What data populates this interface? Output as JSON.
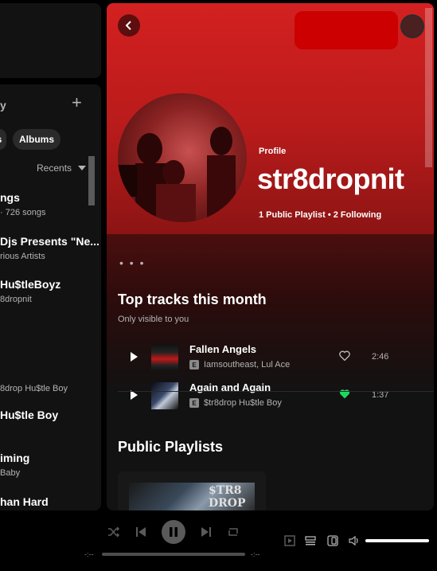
{
  "library": {
    "heading": "y",
    "add_label": "+",
    "chips": [
      "s",
      "Albums"
    ],
    "sort_label": "Recents",
    "items": [
      {
        "title": "ngs",
        "subtitle": "· 726 songs"
      },
      {
        "title": "Djs Presents \"Ne...",
        "subtitle": "rious Artists"
      },
      {
        "title": "Hu$tleBoyz",
        "subtitle": "8dropnit"
      },
      {
        "title": "",
        "subtitle": "8drop Hu$tle Boy"
      },
      {
        "title": "Hu$tle Boy",
        "subtitle": ""
      },
      {
        "title": "iming",
        "subtitle": "Baby"
      },
      {
        "title": "han Hard",
        "subtitle": ""
      }
    ]
  },
  "profile": {
    "type_label": "Profile",
    "name": "str8dropnit",
    "stats": "1 Public Playlist • 2 Following",
    "more_label": "• • •"
  },
  "top_tracks": {
    "title": "Top tracks this month",
    "subtitle": "Only visible to you",
    "tracks": [
      {
        "name": "Fallen Angels",
        "artist": "Iamsoutheast, Lul Ace",
        "duration": "2:46",
        "liked": false,
        "badge": "E"
      },
      {
        "name": "Again and Again",
        "artist": "$tr8drop Hu$tle Boy",
        "duration": "1:37",
        "liked": true,
        "badge": "E"
      }
    ]
  },
  "playlists": {
    "title": "Public Playlists",
    "cover_text": "$TR8\nDROP"
  },
  "player": {
    "time_elapsed": "-:--",
    "time_total": "-:--",
    "is_playing": true,
    "volume": 1.0
  },
  "colors": {
    "accent_green": "#1ed760",
    "hero_red": "#d42020",
    "redaction": "#cc0000"
  },
  "icons": {
    "back": "chevron-left-icon",
    "shuffle": "shuffle-icon",
    "previous": "skip-back-icon",
    "pause": "pause-icon",
    "next": "skip-forward-icon",
    "repeat": "repeat-icon",
    "now_playing_view": "now-playing-view-icon",
    "queue": "queue-icon",
    "connect_device": "connect-device-icon",
    "volume": "volume-icon"
  }
}
